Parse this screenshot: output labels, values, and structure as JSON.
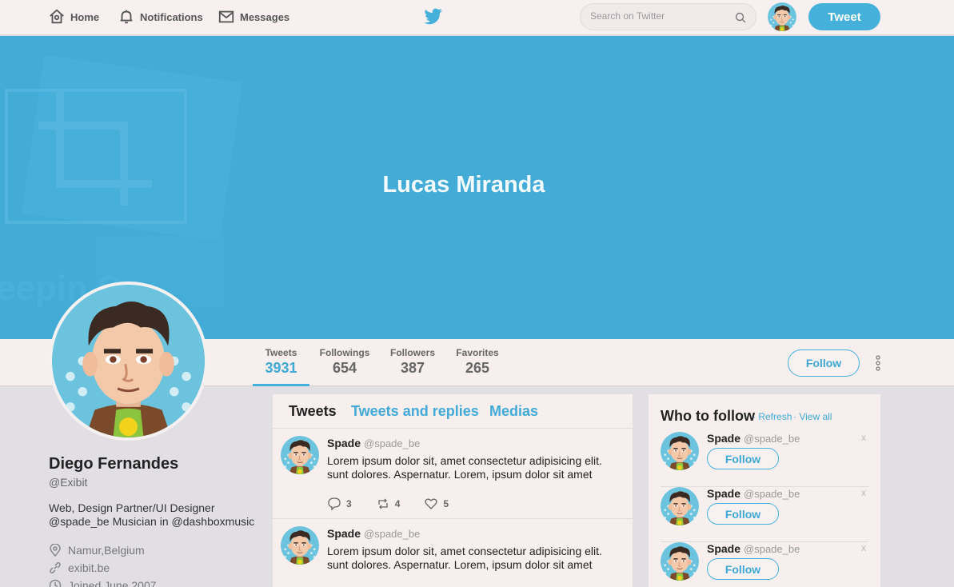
{
  "nav": {
    "home": "Home",
    "notifications": "Notifications",
    "messages": "Messages",
    "search_placeholder": "Search on Twitter",
    "tweet_button": "Tweet"
  },
  "banner": {
    "name": "Lucas Miranda",
    "watermark_text": "eepin S..."
  },
  "stats": [
    {
      "label": "Tweets",
      "value": "3931"
    },
    {
      "label": "Followings",
      "value": "654"
    },
    {
      "label": "Followers",
      "value": "387"
    },
    {
      "label": "Favorites",
      "value": "265"
    }
  ],
  "follow_button": "Follow",
  "profile": {
    "name": "Diego Fernandes",
    "handle": "@Exibit",
    "bio_line1": "Web, Design Partner/UI Designer",
    "bio_line2": "@spade_be Musician in @dashboxmusic",
    "location": "Namur,Belgium",
    "website": "exibit.be",
    "joined": "Joined June 2007"
  },
  "feed": {
    "tabs": [
      "Tweets",
      "Tweets and replies",
      "Medias"
    ],
    "tweets": [
      {
        "name": "Spade",
        "handle": "@spade_be",
        "line1": "Lorem ipsum dolor sit, amet consectetur adipisicing elit.",
        "line2": "sunt dolores. Aspernatur. Lorem, ipsum dolor sit amet",
        "replies": "3",
        "retweets": "4",
        "likes": "5"
      },
      {
        "name": "Spade",
        "handle": "@spade_be",
        "line1": "Lorem ipsum dolor sit, amet consectetur adipisicing elit.",
        "line2": "sunt dolores. Aspernatur. Lorem, ipsum dolor sit amet",
        "replies": "",
        "retweets": "",
        "likes": ""
      }
    ]
  },
  "who_to_follow": {
    "title": "Who to follow",
    "refresh": "Refresh",
    "view_all": "View all",
    "items": [
      {
        "name": "Spade",
        "handle": "@spade_be",
        "button": "Follow",
        "close": "x"
      },
      {
        "name": "Spade",
        "handle": "@spade_be",
        "button": "Follow",
        "close": "x"
      },
      {
        "name": "Spade",
        "handle": "@spade_be",
        "button": "Follow",
        "close": "x"
      }
    ]
  },
  "colors": {
    "accent": "#45b0da",
    "banner": "#42acd7",
    "topbar": "#f8f0f0"
  }
}
